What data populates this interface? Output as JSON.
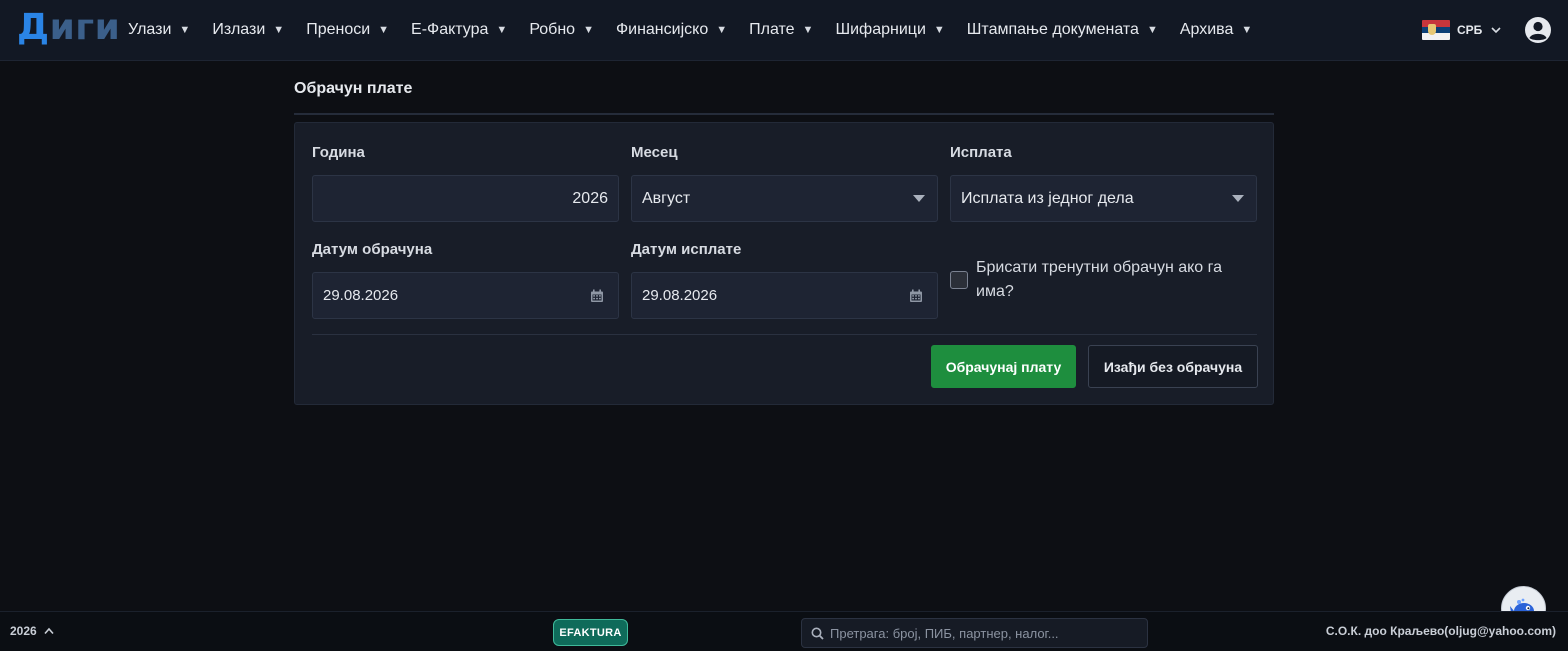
{
  "app": {
    "logo": "Диги"
  },
  "menu": [
    {
      "label": "Улази"
    },
    {
      "label": "Излази"
    },
    {
      "label": "Преноси"
    },
    {
      "label": "Е-Фактура"
    },
    {
      "label": "Робно"
    },
    {
      "label": "Финансијско"
    },
    {
      "label": "Плате"
    },
    {
      "label": "Шифарници"
    },
    {
      "label": "Штампање докумената"
    },
    {
      "label": "Архива"
    }
  ],
  "language": {
    "label": "СРБ"
  },
  "page": {
    "title": "Обрачун плате"
  },
  "form": {
    "year": {
      "label": "Година",
      "value": "2026"
    },
    "month": {
      "label": "Месец",
      "value": "Август"
    },
    "payment": {
      "label": "Исплата",
      "value": "Исплата из једног дела"
    },
    "calc_date": {
      "label": "Датум обрачуна",
      "value": "29.08.2026"
    },
    "pay_date": {
      "label": "Датум исплате",
      "value": "29.08.2026"
    },
    "delete_existing": {
      "label": "Брисати тренутни обрачун ако га има?",
      "checked": false
    },
    "submit_label": "Обрачунај плату",
    "exit_label": "Изађи без обрачуна"
  },
  "footer": {
    "year": "2026",
    "badge": "EFAKTURA",
    "search_placeholder": "Претрага: број, ПИБ, партнер, налог...",
    "company": "С.О.К. доо Краљево(oljug@yahoo.com)"
  },
  "colors": {
    "accent": "#2a84e6",
    "primary_button": "#1e8e3e",
    "badge": "#0f6b5a"
  }
}
